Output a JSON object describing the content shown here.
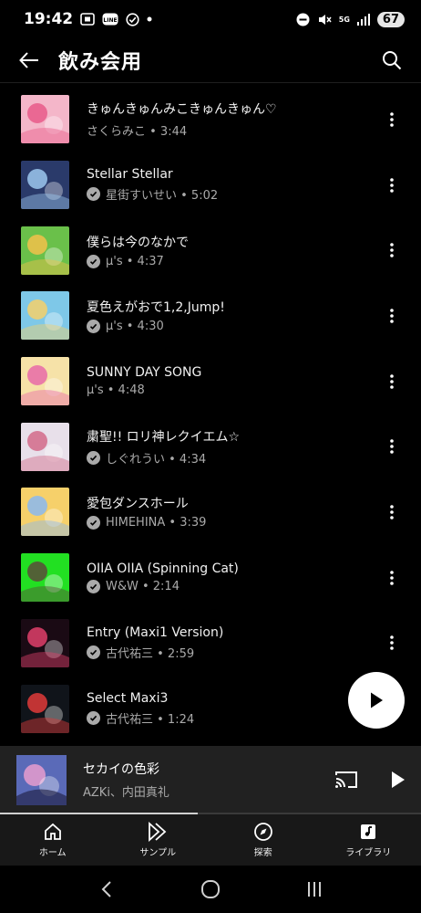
{
  "status": {
    "time": "19:42",
    "signal_5g": "5G",
    "battery": "67",
    "left_icons": [
      "screen-capture-icon",
      "line-app-icon",
      "check-circle-icon",
      "dot-icon"
    ],
    "right_icons": [
      "do-not-disturb-icon",
      "mute-icon",
      "5g-icon",
      "signal-icon",
      "battery-icon"
    ]
  },
  "header": {
    "title": "飲み会用"
  },
  "tracks": [
    {
      "title": "きゅんきゅんみこきゅんきゅん♡",
      "artist": "さくらみこ",
      "duration": "3:44",
      "sub": "さくらみこ • 3:44",
      "verified": false,
      "art": {
        "bg": "#f4b6c9",
        "accent": "#e85a8a"
      }
    },
    {
      "title": "Stellar Stellar",
      "artist": "星街すいせい",
      "duration": "5:02",
      "sub": "星街すいせい • 5:02",
      "verified": true,
      "art": {
        "bg": "#2a3a6a",
        "accent": "#9cc8ee"
      }
    },
    {
      "title": "僕らは今のなかで",
      "artist": "μ's",
      "duration": "4:37",
      "sub": "μ's • 4:37",
      "verified": true,
      "art": {
        "bg": "#6ac04a",
        "accent": "#f2c14a"
      }
    },
    {
      "title": "夏色えがおで1,2,Jump!",
      "artist": "μ's",
      "duration": "4:30",
      "sub": "μ's • 4:30",
      "verified": true,
      "art": {
        "bg": "#7ec8e8",
        "accent": "#f4d06a"
      }
    },
    {
      "title": "SUNNY DAY SONG",
      "artist": "μ's",
      "duration": "4:48",
      "sub": "μ's • 4:48",
      "verified": false,
      "art": {
        "bg": "#f6e2a8",
        "accent": "#e86aa8"
      }
    },
    {
      "title": "粛聖!! ロリ神レクイエム☆",
      "artist": "しぐれうい",
      "duration": "4:34",
      "sub": "しぐれうい • 4:34",
      "verified": true,
      "art": {
        "bg": "#e8e0ea",
        "accent": "#d26a8a"
      }
    },
    {
      "title": "愛包ダンスホール",
      "artist": "HIMEHINA",
      "duration": "3:39",
      "sub": "HIMEHINA • 3:39",
      "verified": true,
      "art": {
        "bg": "#f6d06a",
        "accent": "#8ab8f0"
      }
    },
    {
      "title": "OIIA OIIA (Spinning Cat)",
      "artist": "W&W",
      "duration": "2:14",
      "sub": "W&W • 2:14",
      "verified": true,
      "art": {
        "bg": "#22e022",
        "accent": "#5a4a3a"
      }
    },
    {
      "title": "Entry (Maxi1 Version)",
      "artist": "古代祐三",
      "duration": "2:59",
      "sub": "古代祐三 • 2:59",
      "verified": true,
      "art": {
        "bg": "#1a0a14",
        "accent": "#e0406a"
      }
    },
    {
      "title": "Select Maxi3",
      "artist": "古代祐三",
      "duration": "1:24",
      "sub": "古代祐三 • 1:24",
      "verified": true,
      "art": {
        "bg": "#10141a",
        "accent": "#e03a3a"
      }
    }
  ],
  "now_playing": {
    "title": "セカイの色彩",
    "artist": "AZKi、内田真礼",
    "progress": 0.47,
    "art": {
      "bg": "#5a6ab8",
      "accent": "#f0a0d0"
    }
  },
  "bottom_nav": [
    {
      "label": "ホーム",
      "icon": "home-icon"
    },
    {
      "label": "サンプル",
      "icon": "samples-icon"
    },
    {
      "label": "探索",
      "icon": "explore-icon"
    },
    {
      "label": "ライブラリ",
      "icon": "library-icon"
    }
  ],
  "colors": {
    "background": "#000000",
    "secondary_text": "#aaaaaa",
    "mini_player_bg": "#212121",
    "nav_bg": "#181818"
  }
}
